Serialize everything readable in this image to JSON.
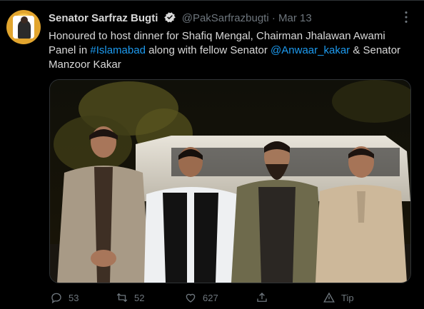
{
  "tweet": {
    "author_name": "Senator Sarfraz Bugti",
    "handle": "@PakSarfrazbugti",
    "separator": "·",
    "date": "Mar 13",
    "text_part1": "Honoured to host dinner for Shafiq Mengal, Chairman Jhalawan Awami Panel in ",
    "hashtag": "#Islamabad",
    "text_part2": " along with fellow Senator ",
    "mention": "@Anwaar_kakar",
    "text_part3": " & Senator Manzoor Kakar"
  },
  "actions": {
    "replies": "53",
    "retweets": "52",
    "likes": "627",
    "tip": "Tip"
  },
  "colors": {
    "background": "#000000",
    "text": "#d9d9d9",
    "muted": "#6e767d",
    "link": "#1d9bf0",
    "border": "#2f3336"
  },
  "icons": [
    "verified-badge-icon",
    "more-icon",
    "reply-icon",
    "retweet-icon",
    "like-icon",
    "share-icon",
    "tip-icon"
  ]
}
